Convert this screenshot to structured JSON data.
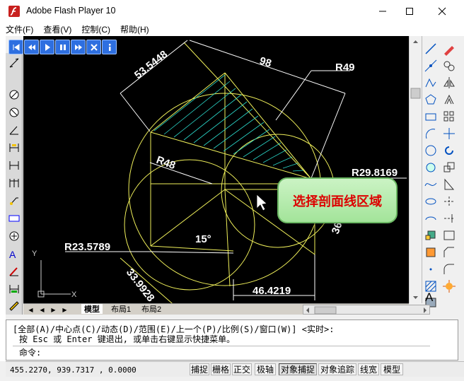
{
  "window": {
    "title": "Adobe Flash Player 10"
  },
  "menu": [
    "文件(F)",
    "查看(V)",
    "控制(C)",
    "帮助(H)"
  ],
  "player_controls": [
    "first-icon",
    "rewind-icon",
    "play-icon",
    "pause-icon",
    "forward-icon",
    "close-x-icon",
    "info-icon"
  ],
  "drawing": {
    "dims": [
      "53.5448",
      "98",
      "R49",
      "R29.8169",
      "R48",
      "15°",
      "R23.5789",
      "33.9928",
      "46.4219",
      "36"
    ],
    "ucs": {
      "y": "Y",
      "x": "X"
    }
  },
  "callout": {
    "text": "选择剖面线区域"
  },
  "tabs": [
    "模型",
    "布局1",
    "布局2"
  ],
  "command": {
    "line1": "[全部(A)/中心点(C)/动态(D)/范围(E)/上一个(P)/比例(S)/窗口(W)] <实时>:",
    "line2": "按 Esc 或 Enter 键退出, 或单击右键显示快捷菜单。",
    "prompt": "命令:"
  },
  "status": {
    "coords": "455.2270, 939.7317 , 0.0000",
    "buttons": [
      "捕捉",
      "栅格",
      "正交",
      "极轴",
      "对象捕捉",
      "对象追踪",
      "线宽",
      "模型"
    ]
  }
}
